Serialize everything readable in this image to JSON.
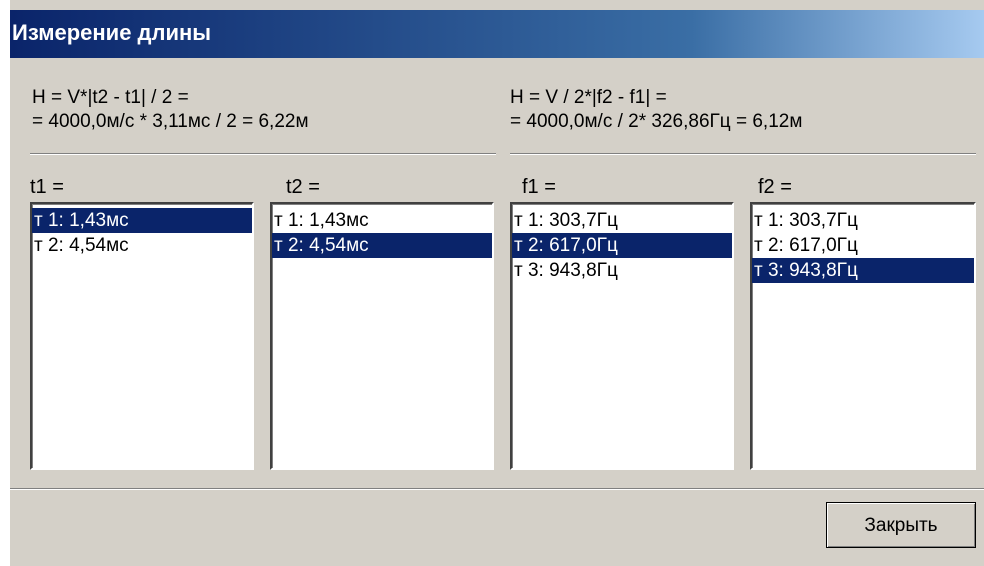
{
  "window": {
    "title": "Измерение длины"
  },
  "formulas": {
    "time": {
      "line1": "H = V*|t2 - t1| / 2 =",
      "line2": "= 4000,0м/с * 3,11мс / 2 = 6,22м"
    },
    "freq": {
      "line1": "H = V / 2*|f2 - f1| =",
      "line2": "= 4000,0м/с / 2* 326,86Гц = 6,12м"
    }
  },
  "lists": [
    {
      "label": "t1 =",
      "items": [
        "т 1: 1,43мс",
        "т 2: 4,54мс"
      ],
      "selected": 0
    },
    {
      "label": "t2 =",
      "items": [
        "т 1: 1,43мс",
        "т 2: 4,54мс"
      ],
      "selected": 1
    },
    {
      "label": "f1 =",
      "items": [
        "т 1: 303,7Гц",
        "т 2: 617,0Гц",
        "т 3: 943,8Гц"
      ],
      "selected": 1
    },
    {
      "label": "f2 =",
      "items": [
        "т 1: 303,7Гц",
        "т 2: 617,0Гц",
        "т 3: 943,8Гц"
      ],
      "selected": 2
    }
  ],
  "buttons": {
    "close": "Закрыть"
  },
  "colors": {
    "titlebar_start": "#0a246a",
    "titlebar_end": "#a6caf0",
    "selection": "#0a246a",
    "dialog_bg": "#d4d0c8"
  }
}
